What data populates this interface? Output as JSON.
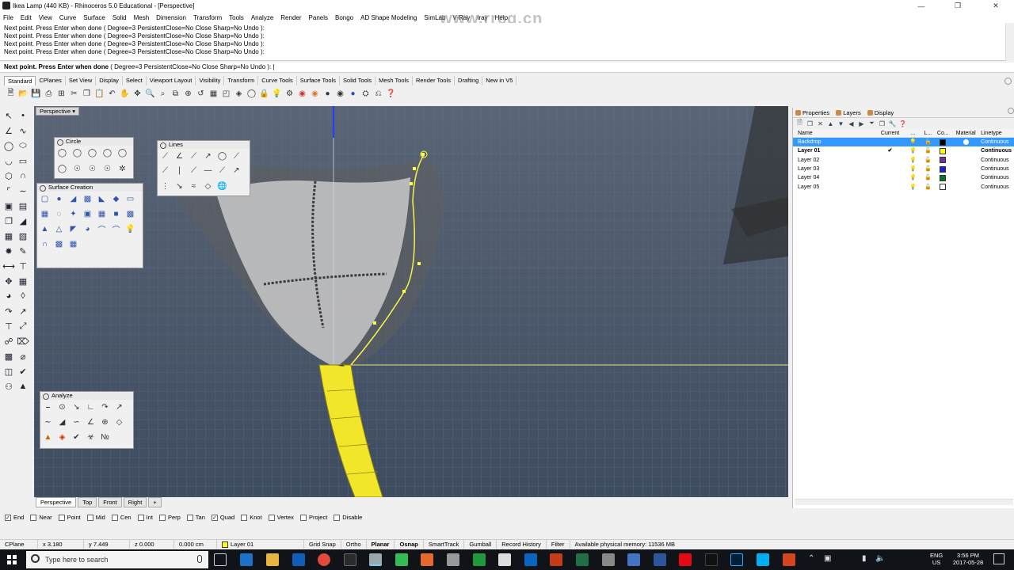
{
  "window": {
    "title": "Ikea Lamp (440 KB) - Rhinoceros 5.0 Educational - [Perspective]"
  },
  "menu": [
    "File",
    "Edit",
    "View",
    "Curve",
    "Surface",
    "Solid",
    "Mesh",
    "Dimension",
    "Transform",
    "Tools",
    "Analyze",
    "Render",
    "Panels",
    "Bongo",
    "AD Shape Modeling",
    "SimLab",
    "V-Ray",
    "Iray",
    "Help"
  ],
  "command": {
    "history": [
      "Next point. Press Enter when done ( Degree=3  PersistentClose=No  Close  Sharp=No  Undo ):",
      "Next point. Press Enter when done ( Degree=3  PersistentClose=No  Close  Sharp=No  Undo ):",
      "Next point. Press Enter when done ( Degree=3  PersistentClose=No  Close  Sharp=No  Undo ):",
      "Next point. Press Enter when done ( Degree=3  PersistentClose=No  Close  Sharp=No  Undo ):"
    ],
    "prompt_bold": "Next point. Press Enter when done",
    "prompt_rest": " ( Degree=3  PersistentClose=No  Close  Sharp=No  Undo ): |"
  },
  "toolbar_tabs": [
    "Standard",
    "CPlanes",
    "Set View",
    "Display",
    "Select",
    "Viewport Layout",
    "Visibility",
    "Transform",
    "Curve Tools",
    "Surface Tools",
    "Solid Tools",
    "Mesh Tools",
    "Render Tools",
    "Drafting",
    "New in V5"
  ],
  "viewport": {
    "label": "Perspective"
  },
  "panels": {
    "circle": "Circle",
    "lines": "Lines",
    "surface": "Surface Creation",
    "analyze": "Analyze"
  },
  "right_panel": {
    "tabs": [
      "Properties",
      "Layers",
      "Display"
    ],
    "columns": [
      "Name",
      "Current",
      "…",
      "L...",
      "Co...",
      "Material",
      "Linetype"
    ],
    "layers": [
      {
        "name": "Backdrop",
        "current": "",
        "color": "#000000",
        "linetype": "Continuous",
        "selected": true
      },
      {
        "name": "Layer 01",
        "current": "✔",
        "color": "#ffff00",
        "linetype": "Continuous",
        "bold": true
      },
      {
        "name": "Layer 02",
        "current": "",
        "color": "#7030a0",
        "linetype": "Continuous"
      },
      {
        "name": "Layer 03",
        "current": "",
        "color": "#1f1fd0",
        "linetype": "Continuous"
      },
      {
        "name": "Layer 04",
        "current": "",
        "color": "#007a20",
        "linetype": "Continuous"
      },
      {
        "name": "Layer 05",
        "current": "",
        "color": "#ffffff",
        "linetype": "Continuous"
      }
    ]
  },
  "view_tabs": [
    "Perspective",
    "Top",
    "Front",
    "Right",
    "+"
  ],
  "osnap": [
    {
      "label": "End",
      "checked": true
    },
    {
      "label": "Near",
      "checked": false
    },
    {
      "label": "Point",
      "checked": false
    },
    {
      "label": "Mid",
      "checked": false
    },
    {
      "label": "Cen",
      "checked": false
    },
    {
      "label": "Int",
      "checked": false
    },
    {
      "label": "Perp",
      "checked": false
    },
    {
      "label": "Tan",
      "checked": false
    },
    {
      "label": "Quad",
      "checked": true
    },
    {
      "label": "Knot",
      "checked": false
    },
    {
      "label": "Vertex",
      "checked": false
    },
    {
      "label": "Project",
      "checked": false
    },
    {
      "label": "Disable",
      "checked": false
    }
  ],
  "status": {
    "cplane": "CPlane",
    "x": "x 3.180",
    "y": "y 7.449",
    "z": "z 0.000",
    "dist": "0.000 cm",
    "layer": "Layer 01",
    "grid_snap": "Grid Snap",
    "ortho": "Ortho",
    "planar": "Planar",
    "osnap": "Osnap",
    "smarttrack": "SmartTrack",
    "gumball": "Gumball",
    "record_history": "Record History",
    "filter": "Filter",
    "memory": "Available physical memory: 11536 MB"
  },
  "taskbar": {
    "search_placeholder": "Type here to search",
    "lang": "ENG",
    "region": "US",
    "time": "3:56 PM",
    "date": "2017-05-28"
  },
  "watermark": "www.rrcg.cn",
  "colors": {
    "selection": "#3399ff",
    "curve": "#ffff00",
    "viewport_bg": "#4d5a6c"
  }
}
